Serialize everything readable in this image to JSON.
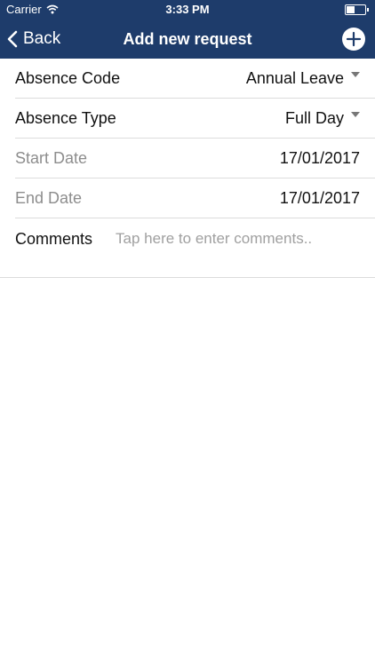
{
  "status_bar": {
    "carrier": "Carrier",
    "time": "3:33 PM"
  },
  "nav": {
    "back_label": "Back",
    "title": "Add new request"
  },
  "form": {
    "absence_code": {
      "label": "Absence Code",
      "value": "Annual Leave"
    },
    "absence_type": {
      "label": "Absence Type",
      "value": "Full Day"
    },
    "start_date": {
      "label": "Start Date",
      "value": "17/01/2017"
    },
    "end_date": {
      "label": "End Date",
      "value": "17/01/2017"
    },
    "comments": {
      "label": "Comments",
      "placeholder": "Tap here to enter comments.."
    }
  },
  "icons": {
    "wifi": "wifi-icon",
    "battery": "battery-icon",
    "back": "chevron-left-icon",
    "add": "plus-circle-icon",
    "dropdown": "caret-down-icon"
  },
  "colors": {
    "navbar": "#1e3c6b",
    "separator": "#dcdcdc",
    "muted_label": "#8d8d8d"
  }
}
